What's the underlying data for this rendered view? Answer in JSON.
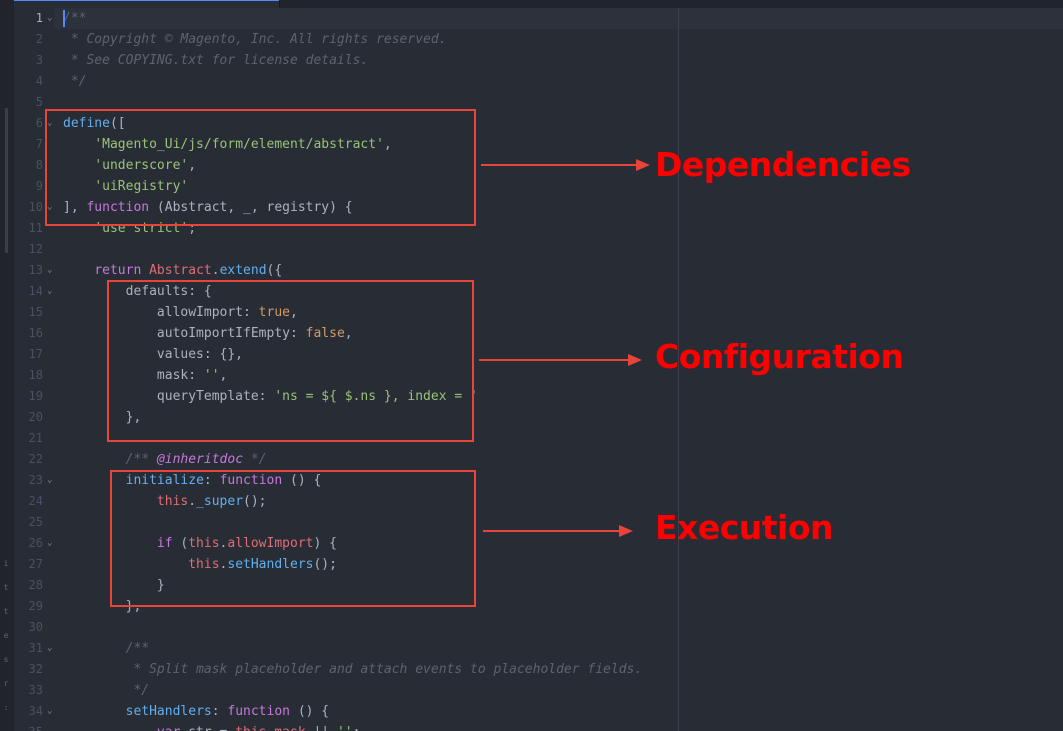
{
  "editor": {
    "theme_colors": {
      "background": "#282c34",
      "gutter_text": "#495162",
      "comment": "#5c6370",
      "keyword": "#c678dd",
      "string": "#98c379",
      "function": "#61afef",
      "class": "#e5c07b",
      "constant": "#d19a66",
      "property": "#e06c75",
      "cursor": "#528bff",
      "annotation_red": "#e8443a",
      "annotation_text": "#ff0000"
    },
    "active_line": 1,
    "fold_markers_at_lines": [
      1,
      6,
      10,
      13,
      14,
      23,
      26,
      31,
      34
    ],
    "lines": [
      {
        "no": "1",
        "tokens": [
          {
            "t": "comment",
            "v": "/**"
          }
        ]
      },
      {
        "no": "2",
        "tokens": [
          {
            "t": "comment",
            "v": " * Copyright © Magento, Inc. All rights reserved."
          }
        ]
      },
      {
        "no": "3",
        "tokens": [
          {
            "t": "comment",
            "v": " * See COPYING.txt for license details."
          }
        ]
      },
      {
        "no": "4",
        "tokens": [
          {
            "t": "comment",
            "v": " */"
          }
        ]
      },
      {
        "no": "5",
        "tokens": []
      },
      {
        "no": "6",
        "tokens": [
          {
            "t": "func",
            "v": "define"
          },
          {
            "t": "plain",
            "v": "(["
          }
        ]
      },
      {
        "no": "7",
        "tokens": [
          {
            "t": "plain",
            "v": "    "
          },
          {
            "t": "string",
            "v": "'Magento_Ui/js/form/element/abstract'"
          },
          {
            "t": "plain",
            "v": ","
          }
        ]
      },
      {
        "no": "8",
        "tokens": [
          {
            "t": "plain",
            "v": "    "
          },
          {
            "t": "string",
            "v": "'underscore'"
          },
          {
            "t": "plain",
            "v": ","
          }
        ]
      },
      {
        "no": "9",
        "tokens": [
          {
            "t": "plain",
            "v": "    "
          },
          {
            "t": "string",
            "v": "'uiRegistry'"
          }
        ]
      },
      {
        "no": "10",
        "tokens": [
          {
            "t": "plain",
            "v": "], "
          },
          {
            "t": "keyword",
            "v": "function"
          },
          {
            "t": "plain",
            "v": " (Abstract, _, registry) {"
          }
        ]
      },
      {
        "no": "11",
        "tokens": [
          {
            "t": "plain",
            "v": "    "
          },
          {
            "t": "string",
            "v": "'use strict'"
          },
          {
            "t": "plain",
            "v": ";"
          }
        ]
      },
      {
        "no": "12",
        "tokens": []
      },
      {
        "no": "13",
        "tokens": [
          {
            "t": "plain",
            "v": "    "
          },
          {
            "t": "keyword",
            "v": "return"
          },
          {
            "t": "plain",
            "v": " "
          },
          {
            "t": "prop",
            "v": "Abstract"
          },
          {
            "t": "plain",
            "v": "."
          },
          {
            "t": "func",
            "v": "extend"
          },
          {
            "t": "plain",
            "v": "({"
          }
        ]
      },
      {
        "no": "14",
        "tokens": [
          {
            "t": "plain",
            "v": "        defaults: {"
          }
        ]
      },
      {
        "no": "15",
        "tokens": [
          {
            "t": "plain",
            "v": "            allowImport: "
          },
          {
            "t": "const",
            "v": "true"
          },
          {
            "t": "plain",
            "v": ","
          }
        ]
      },
      {
        "no": "16",
        "tokens": [
          {
            "t": "plain",
            "v": "            autoImportIfEmpty: "
          },
          {
            "t": "const",
            "v": "false"
          },
          {
            "t": "plain",
            "v": ","
          }
        ]
      },
      {
        "no": "17",
        "tokens": [
          {
            "t": "plain",
            "v": "            values: {},"
          }
        ]
      },
      {
        "no": "18",
        "tokens": [
          {
            "t": "plain",
            "v": "            mask: "
          },
          {
            "t": "string",
            "v": "''"
          },
          {
            "t": "plain",
            "v": ","
          }
        ]
      },
      {
        "no": "19",
        "tokens": [
          {
            "t": "plain",
            "v": "            queryTemplate: "
          },
          {
            "t": "string",
            "v": "'ns = ${ $.ns }, index = '"
          }
        ]
      },
      {
        "no": "20",
        "tokens": [
          {
            "t": "plain",
            "v": "        },"
          }
        ]
      },
      {
        "no": "21",
        "tokens": []
      },
      {
        "no": "22",
        "tokens": [
          {
            "t": "plain",
            "v": "        "
          },
          {
            "t": "comment",
            "v": "/** "
          },
          {
            "t": "tag",
            "v": "@inheritdoc"
          },
          {
            "t": "comment",
            "v": " */"
          }
        ]
      },
      {
        "no": "23",
        "tokens": [
          {
            "t": "plain",
            "v": "        "
          },
          {
            "t": "func",
            "v": "initialize"
          },
          {
            "t": "plain",
            "v": ": "
          },
          {
            "t": "keyword",
            "v": "function"
          },
          {
            "t": "plain",
            "v": " () {"
          }
        ]
      },
      {
        "no": "24",
        "tokens": [
          {
            "t": "plain",
            "v": "            "
          },
          {
            "t": "prop",
            "v": "this"
          },
          {
            "t": "plain",
            "v": "."
          },
          {
            "t": "func",
            "v": "_super"
          },
          {
            "t": "plain",
            "v": "();"
          }
        ]
      },
      {
        "no": "25",
        "tokens": []
      },
      {
        "no": "26",
        "tokens": [
          {
            "t": "plain",
            "v": "            "
          },
          {
            "t": "keyword",
            "v": "if"
          },
          {
            "t": "plain",
            "v": " ("
          },
          {
            "t": "prop",
            "v": "this"
          },
          {
            "t": "plain",
            "v": "."
          },
          {
            "t": "prop",
            "v": "allowImport"
          },
          {
            "t": "plain",
            "v": ") {"
          }
        ]
      },
      {
        "no": "27",
        "tokens": [
          {
            "t": "plain",
            "v": "                "
          },
          {
            "t": "prop",
            "v": "this"
          },
          {
            "t": "plain",
            "v": "."
          },
          {
            "t": "func",
            "v": "setHandlers"
          },
          {
            "t": "plain",
            "v": "();"
          }
        ]
      },
      {
        "no": "28",
        "tokens": [
          {
            "t": "plain",
            "v": "            }"
          }
        ]
      },
      {
        "no": "29",
        "tokens": [
          {
            "t": "plain",
            "v": "        },"
          }
        ]
      },
      {
        "no": "30",
        "tokens": []
      },
      {
        "no": "31",
        "tokens": [
          {
            "t": "plain",
            "v": "        "
          },
          {
            "t": "comment",
            "v": "/**"
          }
        ]
      },
      {
        "no": "32",
        "tokens": [
          {
            "t": "plain",
            "v": "        "
          },
          {
            "t": "comment",
            "v": " * Split mask placeholder and attach events to placeholder fields."
          }
        ]
      },
      {
        "no": "33",
        "tokens": [
          {
            "t": "plain",
            "v": "        "
          },
          {
            "t": "comment",
            "v": " */"
          }
        ]
      },
      {
        "no": "34",
        "tokens": [
          {
            "t": "plain",
            "v": "        "
          },
          {
            "t": "func",
            "v": "setHandlers"
          },
          {
            "t": "plain",
            "v": ": "
          },
          {
            "t": "keyword",
            "v": "function"
          },
          {
            "t": "plain",
            "v": " () {"
          }
        ]
      },
      {
        "no": "35",
        "tokens": [
          {
            "t": "plain",
            "v": "            "
          },
          {
            "t": "keyword",
            "v": "var"
          },
          {
            "t": "plain",
            "v": " str = "
          },
          {
            "t": "prop",
            "v": "this"
          },
          {
            "t": "plain",
            "v": "."
          },
          {
            "t": "prop",
            "v": "mask"
          },
          {
            "t": "plain",
            "v": " || "
          },
          {
            "t": "string",
            "v": "''"
          },
          {
            "t": "plain",
            "v": ";"
          }
        ]
      }
    ]
  },
  "annotations": {
    "dependencies": "Dependencies",
    "configuration": "Configuration",
    "execution": "Execution"
  }
}
